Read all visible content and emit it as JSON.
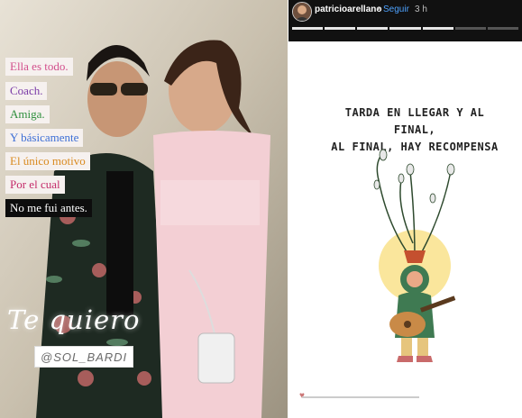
{
  "left_story": {
    "text_tags": [
      "Ella es todo.",
      "Coach.",
      "Amiga.",
      "Y básicamente",
      "El único motivo",
      "Por el cual",
      "No me fui antes."
    ],
    "script_text": "Te quiero",
    "mention": "@SOL_BARDI"
  },
  "right_story": {
    "username": "patricioarellano",
    "follow_label": "Seguir",
    "time_ago": "3 h",
    "quote_lines": [
      "TARDA EN LLEGAR Y AL FINAL,",
      "AL FINAL, HAY RECOMPENSA"
    ]
  },
  "colors": {
    "follow_blue": "#4ea3ff",
    "header_bg": "#111111"
  },
  "icons": [
    "avatar",
    "reply-icon"
  ]
}
